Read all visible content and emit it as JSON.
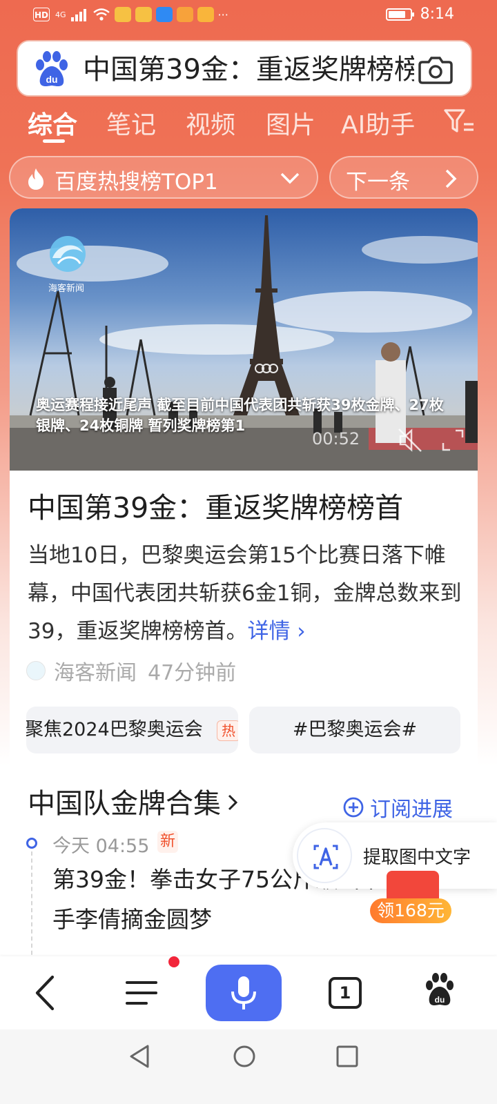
{
  "status_bar": {
    "hd_label": "HD",
    "network_label": "4G",
    "more_label": "···",
    "time": "8:14"
  },
  "search": {
    "query": "中国第39金：重返奖牌榜榜首"
  },
  "tabs": [
    {
      "label": "综合",
      "active": true
    },
    {
      "label": "笔记",
      "active": false
    },
    {
      "label": "视频",
      "active": false
    },
    {
      "label": "图片",
      "active": false
    },
    {
      "label": "AI助手",
      "active": false
    }
  ],
  "hot_chip": {
    "label": "百度热搜榜TOP1",
    "next_label": "下一条"
  },
  "video": {
    "watermark": "海客新闻",
    "caption": "奥运赛程接近尾声 截至目前中国代表团共斩获39枚金牌、27枚银牌、24枚铜牌 暂列奖牌榜第1",
    "time": "00:52"
  },
  "article": {
    "title": "中国第39金：重返奖牌榜榜首",
    "body": "当地10日，巴黎奥运会第15个比赛日落下帷幕，中国代表团共斩获6金1铜，金牌总数来到39，重返奖牌榜榜首。",
    "detail_label": "详情 ›",
    "source": "海客新闻",
    "published": "47分钟前"
  },
  "topics": [
    {
      "label": "聚焦2024巴黎奥运会",
      "tag": "热"
    },
    {
      "label": "#巴黎奥运会#"
    }
  ],
  "collection": {
    "title": "中国队金牌合集",
    "subscribe_label": "订阅进展",
    "items": [
      {
        "time": "今天 04:55",
        "tag": "新",
        "title": "第39金！拳击女子75公斤级 中国选手李倩摘金圆梦"
      }
    ]
  },
  "ocr_float": {
    "label": "提取图中文字"
  },
  "reward": {
    "label": "领168元"
  },
  "bottom_nav": {
    "tab_count": "1"
  },
  "colors": {
    "brand_red": "#ee6a50",
    "link_blue": "#3f64e5",
    "voice_blue": "#4e6ef2"
  }
}
